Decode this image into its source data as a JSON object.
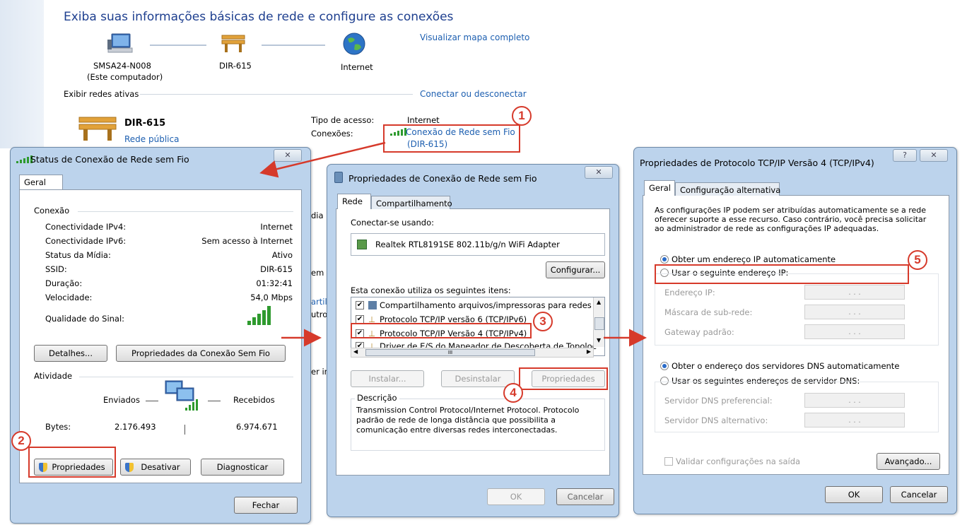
{
  "background": {
    "heading": "Exiba suas informações básicas de rede e configure as conexões",
    "map_link": "Visualizar mapa completo",
    "nodes": [
      {
        "label": "SMSA24-N008",
        "sub": "(Este computador)",
        "icon": "computer-icon"
      },
      {
        "label": "DIR-615",
        "sub": "",
        "icon": "bench-network-icon"
      },
      {
        "label": "Internet",
        "sub": "",
        "icon": "globe-icon"
      }
    ],
    "active_networks_label": "Exibir redes ativas",
    "connect_link": "Conectar ou desconectar",
    "network_name": "DIR-615",
    "network_type": "Rede pública",
    "access_type_label": "Tipo de acesso:",
    "access_type_value": "Internet",
    "connections_label": "Conexões:",
    "connection_link_line1": "Conexão de Rede sem Fio",
    "connection_link_line2": "(DIR-615)",
    "partial_texts": [
      "dia",
      "em",
      "artil",
      "utro",
      "er in"
    ]
  },
  "status_dialog": {
    "title": "Status de Conexão de Rede sem Fio",
    "close": "✕",
    "tab": "Geral",
    "section_connection": "Conexão",
    "rows": [
      {
        "label": "Conectividade IPv4:",
        "value": "Internet"
      },
      {
        "label": "Conectividade IPv6:",
        "value": "Sem acesso à Internet"
      },
      {
        "label": "Status da Mídia:",
        "value": "Ativo"
      },
      {
        "label": "SSID:",
        "value": "DIR-615"
      },
      {
        "label": "Duração:",
        "value": "01:32:41"
      },
      {
        "label": "Velocidade:",
        "value": "54,0 Mbps"
      }
    ],
    "signal_label": "Qualidade do Sinal:",
    "details_button": "Detalhes...",
    "wireless_props_button": "Propriedades da Conexão Sem Fio",
    "section_activity": "Atividade",
    "sent_label": "Enviados",
    "received_label": "Recebidos",
    "bytes_label": "Bytes:",
    "bytes_sent": "2.176.493",
    "bytes_received": "6.974.671",
    "properties_button": "Propriedades",
    "disable_button": "Desativar",
    "diagnose_button": "Diagnosticar",
    "close_button": "Fechar"
  },
  "props_dialog": {
    "title": "Propriedades de Conexão de Rede sem Fio",
    "close": "✕",
    "tab_network": "Rede",
    "tab_sharing": "Compartilhamento",
    "connect_using_label": "Conectar-se usando:",
    "adapter": "Realtek RTL8191SE 802.11b/g/n WiFi Adapter",
    "configure_button": "Configurar...",
    "items_label": "Esta conexão utiliza os seguintes itens:",
    "items": [
      "Compartilhamento arquivos/impressoras para redes Mic",
      "Protocolo TCP/IP versão 6 (TCP/IPv6)",
      "Protocolo TCP/IP Versão 4 (TCP/IPv4)",
      "Driver de E/S do Mapeador de Descoberta de Topoloc"
    ],
    "scroll_mark": "III",
    "install_button": "Instalar...",
    "uninstall_button": "Desinstalar",
    "properties_button": "Propriedades",
    "description_label": "Descrição",
    "description_text_1": "Transmission Control Protocol/Internet Protocol. Protocolo",
    "description_text_2": "padrão de rede de longa distância que possibilita a",
    "description_text_3": "comunicação entre diversas redes interconectadas.",
    "ok_button": "OK",
    "cancel_button": "Cancelar"
  },
  "tcp_dialog": {
    "title": "Propriedades de Protocolo TCP/IP Versão 4 (TCP/IPv4)",
    "help": "?",
    "close": "✕",
    "tab_general": "Geral",
    "tab_alternate": "Configuração alternativa",
    "intro_1": "As configurações IP podem ser atribuídas automaticamente se a rede",
    "intro_2": "oferecer suporte a esse recurso. Caso contrário, você precisa solicitar",
    "intro_3": "ao administrador de rede as configurações IP adequadas.",
    "auto_ip": "Obter um endereço IP automaticamente",
    "manual_ip": "Usar o seguinte endereço IP:",
    "ip_label": "Endereço IP:",
    "mask_label": "Máscara de sub-rede:",
    "gateway_label": "Gateway padrão:",
    "ip_placeholder": ".       .       .",
    "auto_dns": "Obter o endereço dos servidores DNS automaticamente",
    "manual_dns": "Usar os seguintes endereços de servidor DNS:",
    "dns_pref_label": "Servidor DNS preferencial:",
    "dns_alt_label": "Servidor DNS alternativo:",
    "validate_label": "Validar configurações na saída",
    "advanced_button": "Avançado...",
    "ok_button": "OK",
    "cancel_button": "Cancelar"
  },
  "callouts": [
    "1",
    "2",
    "3",
    "4",
    "5"
  ],
  "colors": {
    "accent_red": "#d63a2b",
    "link_blue": "#1d5fb0",
    "dialog_frame": "#bcd3ec"
  }
}
